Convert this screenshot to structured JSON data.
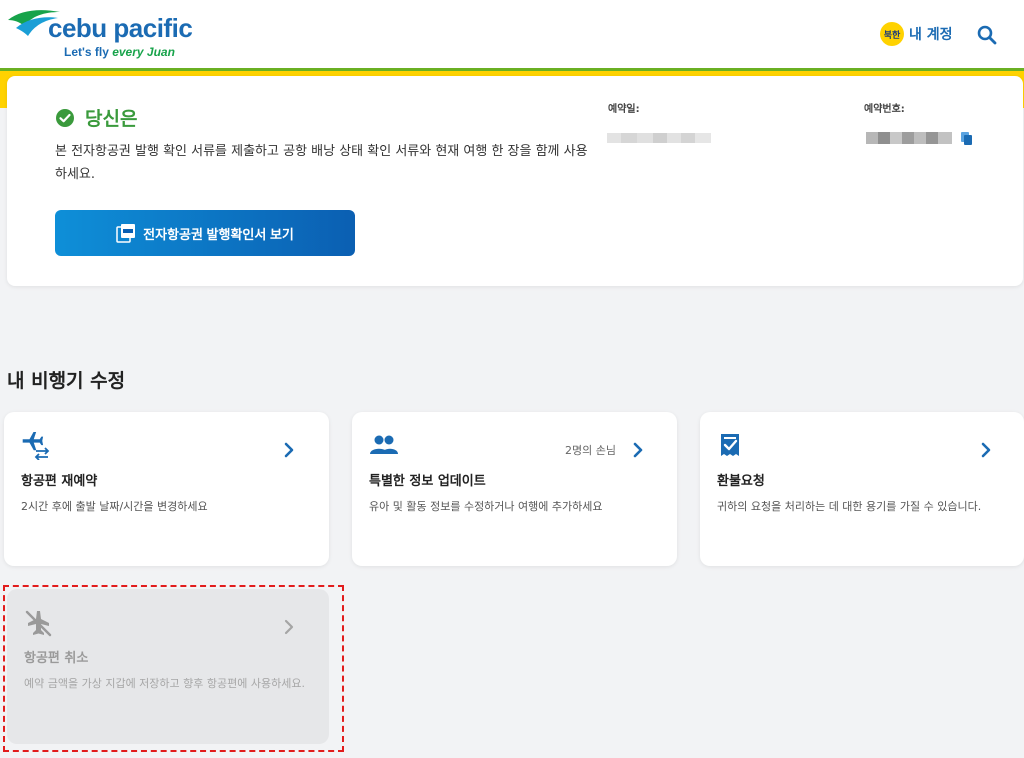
{
  "header": {
    "brand": "cebu pacific",
    "tagline_prefix": "Let's fly ",
    "tagline_emphasis": "every Juan",
    "account_badge": "북한",
    "account_label": "내 계정"
  },
  "booking": {
    "status_title": "당신은",
    "description": "본 전자항공권 발행 확인 서류를 제출하고 공항 배낭 상태 확인 서류와 현재 여행 한 장을 함께 사용하세요.",
    "eticket_button": "전자항공권 발행확인서 보기",
    "booking_date_label": "예약일:",
    "booking_ref_label": "예약번호:"
  },
  "manage": {
    "title": "내 비행기 수정",
    "options": [
      {
        "title": "항공편 재예약",
        "subtitle": "2시간 후에 출발 날짜/시간을 변경하세요",
        "extra": ""
      },
      {
        "title": "특별한 정보 업데이트",
        "subtitle": "유아 및 활동 정보를 수정하거나 여행에 추가하세요",
        "extra": "2명의 손님"
      },
      {
        "title": "환불요청",
        "subtitle": "귀하의 요청을 처리하는 데 대한 용기를 가질 수 있습니다.",
        "extra": ""
      },
      {
        "title": "항공편 취소",
        "subtitle": "예약 금액을 가상 지갑에 저장하고 향후 항공편에 사용하세요.",
        "extra": ""
      }
    ]
  },
  "colors": {
    "brand_blue": "#1b6bb3",
    "accent_yellow": "#ffd200",
    "success_green": "#3a9a3c",
    "highlight_red": "#e21c1c"
  }
}
